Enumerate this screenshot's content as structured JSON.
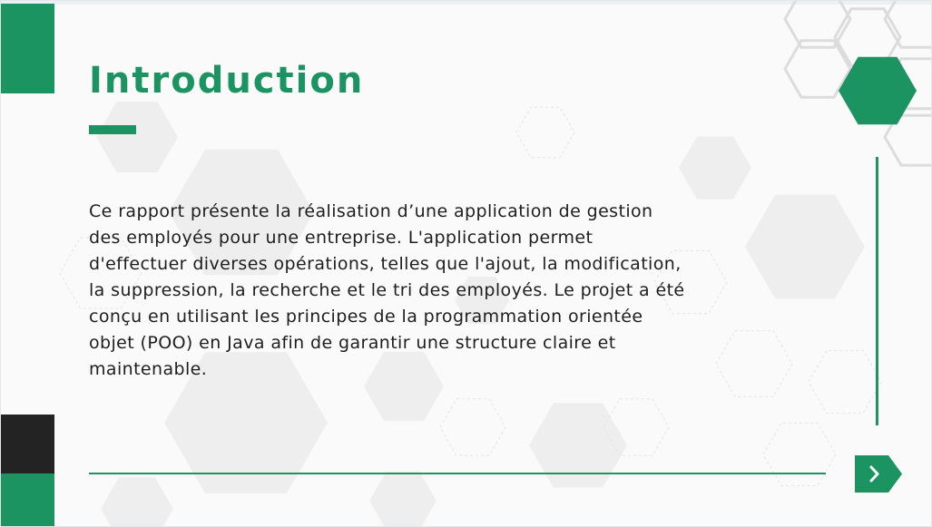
{
  "slide": {
    "title": "Introduction",
    "body": "Ce rapport présente la réalisation d’une application de gestion des employés pour une entreprise. L'application permet d'effectuer diverses opérations, telles que l'ajout, la modification, la suppression, la recherche et le tri des employés. Le projet a été conçu en utilisant les principes de la programmation orientée objet (POO) en Java afin de garantir une structure claire et maintenable."
  },
  "navigation": {
    "next_icon": "chevron-right-icon"
  },
  "colors": {
    "accent": "#1b9462",
    "dark": "#232323",
    "text": "#1e1e1e",
    "hex_fill": "#eeeeee",
    "hex_outline": "#dcdcdc"
  }
}
